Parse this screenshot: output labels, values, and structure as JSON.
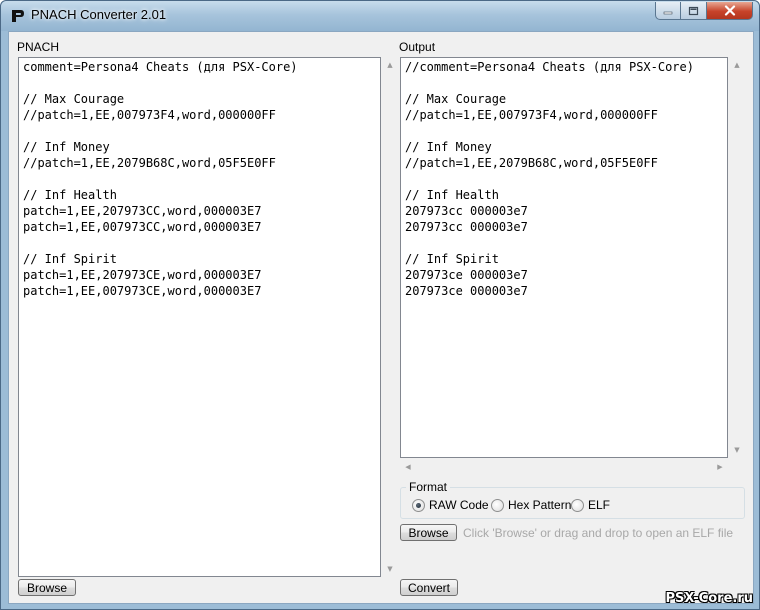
{
  "window": {
    "title": "PNACH Converter 2.01"
  },
  "left_panel": {
    "label": "PNACH",
    "lines": [
      "comment=Persona4 Cheats (для PSX-Core)",
      "",
      "// Max Courage",
      "//patch=1,EE,007973F4,word,000000FF",
      "",
      "// Inf Money",
      "//patch=1,EE,2079B68C,word,05F5E0FF",
      "",
      "// Inf Health",
      "patch=1,EE,207973CC,word,000003E7",
      "patch=1,EE,007973CC,word,000003E7",
      "",
      "// Inf Spirit",
      "patch=1,EE,207973CE,word,000003E7",
      "patch=1,EE,007973CE,word,000003E7"
    ],
    "browse_label": "Browse"
  },
  "right_panel": {
    "label": "Output",
    "lines": [
      "//comment=Persona4 Cheats (для PSX-Core)",
      "",
      "// Max Courage",
      "//patch=1,EE,007973F4,word,000000FF",
      "",
      "// Inf Money",
      "//patch=1,EE,2079B68C,word,05F5E0FF",
      "",
      "// Inf Health",
      "207973cc 000003e7",
      "207973cc 000003e7",
      "",
      "// Inf Spirit",
      "207973ce 000003e7",
      "207973ce 000003e7"
    ],
    "format": {
      "legend": "Format",
      "options": [
        "RAW Code",
        "Hex Pattern",
        "ELF"
      ],
      "selected": "RAW Code"
    },
    "browse_label": "Browse",
    "browse_hint": "Click 'Browse' or drag and drop to open an ELF file",
    "convert_label": "Convert"
  },
  "watermark": "PSX-Core.ru",
  "colors": {
    "close_button": "#c7432a",
    "titlebar": "#a7c4dc",
    "client_bg": "#f0f0f0"
  }
}
